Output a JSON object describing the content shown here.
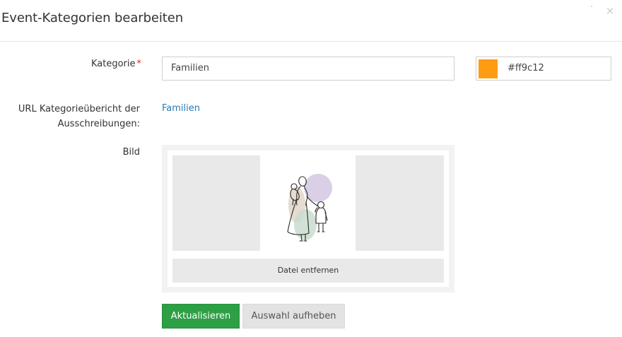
{
  "modal": {
    "title": "Event-Kategorien bearbeiten",
    "close_icon": "close-icon",
    "close_label": "×"
  },
  "form": {
    "category": {
      "label": "Kategorie",
      "required_marker": "*",
      "value": "Familien"
    },
    "color": {
      "swatch_color": "#ff9c12",
      "value": "#ff9c12"
    },
    "url": {
      "label_line1": "URL Kategorieübericht der",
      "label_line2": "Ausschreibungen:",
      "link_text": "Familien"
    },
    "image": {
      "label": "Bild",
      "illustration": "mother-and-children-illustration",
      "remove_label": "Datei entfernen"
    }
  },
  "actions": {
    "update_label": "Aktualisieren",
    "deselect_label": "Auswahl aufheben"
  },
  "colors": {
    "primary_button": "#2d9f45",
    "link": "#2a7ab8",
    "required": "#e02424"
  }
}
